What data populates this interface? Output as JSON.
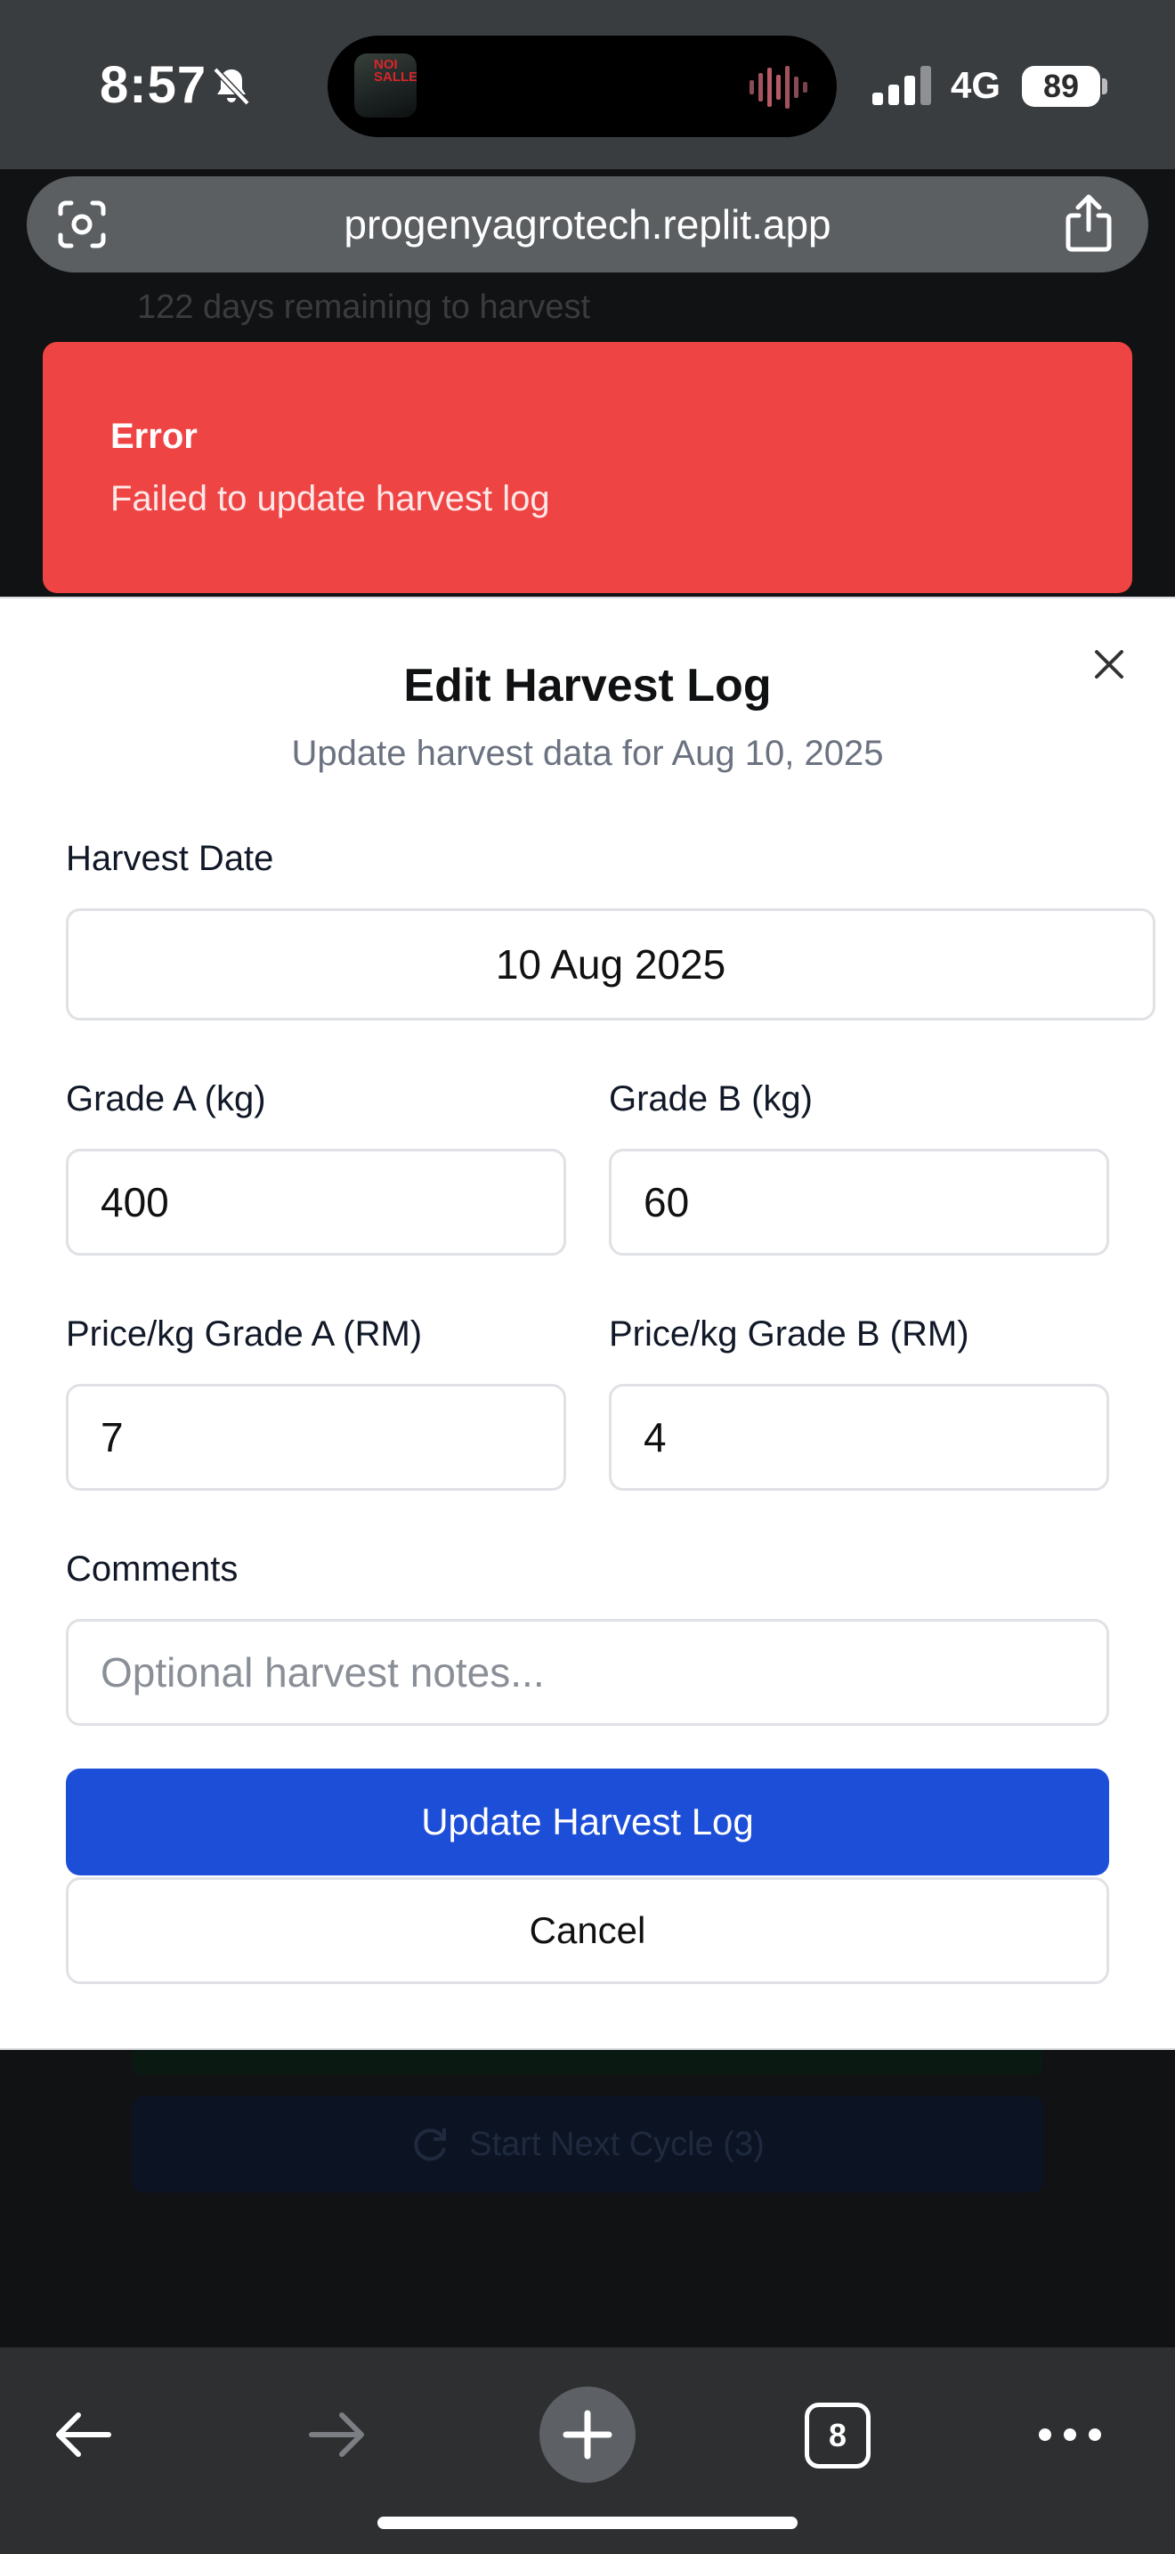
{
  "status_bar": {
    "time": "8:57",
    "network": "4G",
    "battery": "89"
  },
  "browser": {
    "url": "progenyagrotech.replit.app",
    "tab_count": "8"
  },
  "page_behind": {
    "remaining_text": "122 days remaining to harvest",
    "next_cycle_button": "Start Next Cycle (3)"
  },
  "toast": {
    "title": "Error",
    "message": "Failed to update harvest log"
  },
  "dialog": {
    "title": "Edit Harvest Log",
    "subtitle": "Update harvest data for Aug 10, 2025",
    "harvest_date_label": "Harvest Date",
    "harvest_date_value": "10 Aug 2025",
    "grade_a_label": "Grade A (kg)",
    "grade_a_value": "400",
    "grade_b_label": "Grade B (kg)",
    "grade_b_value": "60",
    "price_a_label": "Price/kg Grade A (RM)",
    "price_a_value": "7",
    "price_b_label": "Price/kg Grade B (RM)",
    "price_b_value": "4",
    "comments_label": "Comments",
    "comments_placeholder": "Optional harvest notes...",
    "submit_label": "Update Harvest Log",
    "cancel_label": "Cancel"
  },
  "icons": {
    "bell": "bell-slash-icon",
    "close": "close-icon",
    "back": "arrow-left-icon",
    "forward": "arrow-right-icon",
    "new_tab": "plus-icon",
    "more": "more-dots-icon",
    "share": "share-icon",
    "lens": "camera-lens-icon"
  },
  "colors": {
    "toast_bg": "#ef4444",
    "primary_button": "#1d4ed8",
    "toolbar_bg": "#2d2f31",
    "status_bg": "#3a3d40"
  }
}
